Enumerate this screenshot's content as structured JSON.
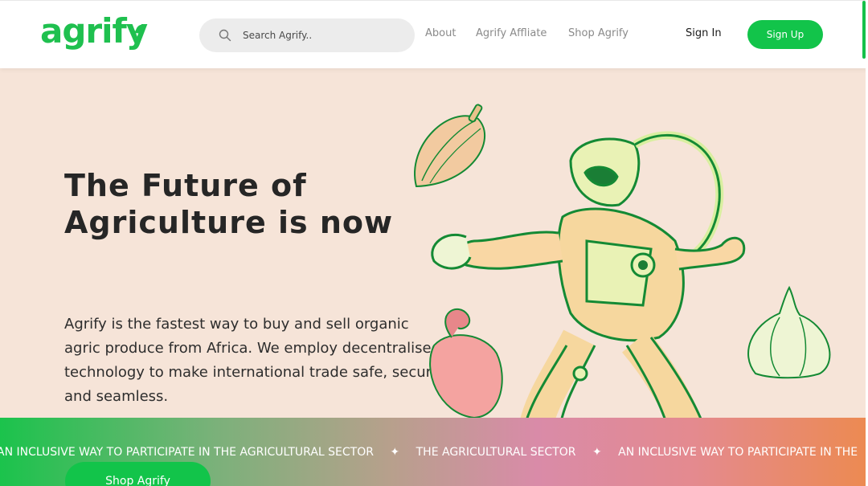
{
  "nav": {
    "logo": "agrify",
    "search_placeholder": "Search Agrify..",
    "links": [
      "About",
      "Agrify Affliate",
      "Shop Agrify"
    ],
    "sign_in": "Sign In",
    "sign_up": "Sign Up"
  },
  "hero": {
    "title": "The Future of Agriculture is now",
    "description": "Agrify is the fastest way to buy and sell organic agric produce from Africa. We employ decentralised technology to make international trade safe, secure and seamless.",
    "cta": "Shop Agrify"
  },
  "ticker": {
    "items": [
      "AN INCLUSIVE WAY TO PARTICIPATE IN THE AGRICULTURAL SECTOR",
      "THE AGRICULTURAL SECTOR",
      "AN INCLUSIVE WAY TO PARTICIPATE IN THE"
    ]
  },
  "colors": {
    "brand_green": "#12c44a",
    "hero_bg": "#f6e4d8",
    "title_text": "#262626"
  },
  "icons": [
    "search-icon",
    "sparkle-icon"
  ]
}
